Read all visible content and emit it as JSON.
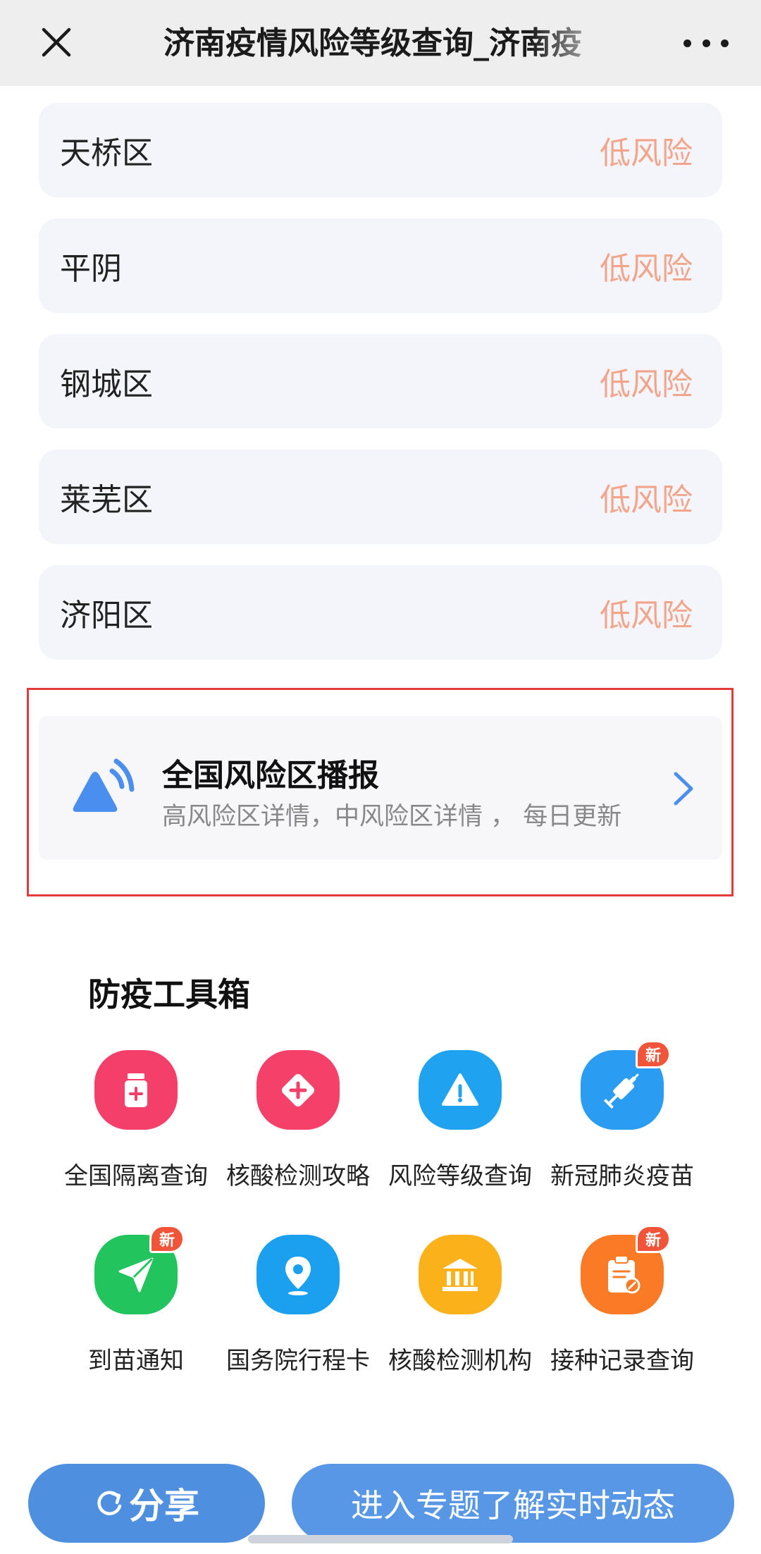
{
  "header": {
    "title": "济南疫情风险等级查询_济南疫",
    "close_icon": "close-icon",
    "more_icon": "more-icon"
  },
  "districts": [
    {
      "name": "天桥区",
      "risk": "低风险"
    },
    {
      "name": "平阴",
      "risk": "低风险"
    },
    {
      "name": "钢城区",
      "risk": "低风险"
    },
    {
      "name": "莱芜区",
      "risk": "低风险"
    },
    {
      "name": "济阳区",
      "risk": "低风险"
    }
  ],
  "broadcast": {
    "title": "全国风险区播报",
    "subtitle": "高风险区详情，中风险区详情 ， 每日更新",
    "icon": "broadcast-icon"
  },
  "toolbox": {
    "title": "防疫工具箱",
    "tools": [
      {
        "label": "全国隔离查询",
        "icon": "medicine-bottle-icon",
        "color": "#f43f6b",
        "badge": ""
      },
      {
        "label": "核酸检测攻略",
        "icon": "diamond-plus-icon",
        "color": "#f54169",
        "badge": ""
      },
      {
        "label": "风险等级查询",
        "icon": "warning-icon",
        "color": "#1fa2f0",
        "badge": ""
      },
      {
        "label": "新冠肺炎疫苗",
        "icon": "syringe-icon",
        "color": "#2a9cf2",
        "badge": "新"
      },
      {
        "label": "到苗通知",
        "icon": "send-icon",
        "color": "#22c45e",
        "badge": "新"
      },
      {
        "label": "国务院行程卡",
        "icon": "location-pin-icon",
        "color": "#1ba0f0",
        "badge": ""
      },
      {
        "label": "核酸检测机构",
        "icon": "institution-icon",
        "color": "#fbb21a",
        "badge": ""
      },
      {
        "label": "接种记录查询",
        "icon": "clipboard-icon",
        "color": "#fa7a26",
        "badge": "新"
      }
    ]
  },
  "footer": {
    "share_label": "分享",
    "enter_label": "进入专题了解实时动态"
  },
  "colors": {
    "risk_low": "#f2a58a",
    "primary_blue": "#5896e6",
    "highlight_red": "#e13b3b"
  }
}
